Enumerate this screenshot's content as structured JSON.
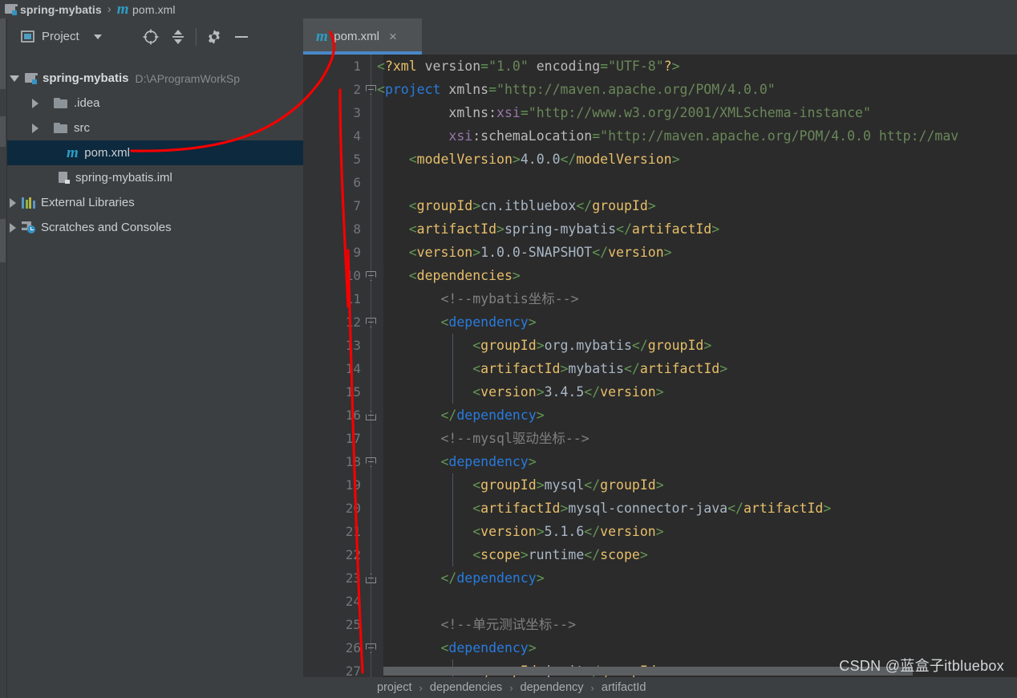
{
  "window": {
    "breadcrumb": [
      {
        "icon": "module-icon",
        "label": "spring-mybatis"
      },
      {
        "icon": "maven-icon",
        "label": "pom.xml"
      }
    ],
    "separator": "›"
  },
  "sidebar": {
    "title": "Project",
    "icons": [
      {
        "name": "locate-target-icon",
        "glyph": "crosshair"
      },
      {
        "name": "collapse-all-icon",
        "glyph": "collapse"
      },
      {
        "name": "settings-gear-icon",
        "glyph": "gear"
      },
      {
        "name": "hide-panel-icon",
        "glyph": "minus"
      }
    ],
    "tree": [
      {
        "label": "spring-mybatis",
        "path": "D:\\AProgramWorkSp",
        "icon": "module-icon",
        "state": "expanded",
        "indent": 0,
        "bold": true,
        "selected": false
      },
      {
        "label": ".idea",
        "path": "",
        "icon": "folder-icon",
        "state": "collapsed",
        "indent": 1,
        "bold": false,
        "selected": false
      },
      {
        "label": "src",
        "path": "",
        "icon": "folder-icon",
        "state": "collapsed",
        "indent": 1,
        "bold": false,
        "selected": false
      },
      {
        "label": "pom.xml",
        "path": "",
        "icon": "maven-icon",
        "state": "leaf",
        "indent": 1,
        "bold": false,
        "selected": true
      },
      {
        "label": "spring-mybatis.iml",
        "path": "",
        "icon": "iml-icon",
        "state": "leaf",
        "indent": 2,
        "bold": false,
        "selected": false
      },
      {
        "label": "External Libraries",
        "path": "",
        "icon": "library-icon",
        "state": "collapsed",
        "indent": 0,
        "bold": false,
        "selected": false
      },
      {
        "label": "Scratches and Consoles",
        "path": "",
        "icon": "scratches-icon",
        "state": "collapsed",
        "indent": 0,
        "bold": false,
        "selected": false
      }
    ]
  },
  "editor": {
    "tab": {
      "label": "pom.xml",
      "icon": "maven-icon",
      "close": "×",
      "active": true
    },
    "breadcrumb": [
      "project",
      "dependencies",
      "dependency",
      "artifactId"
    ],
    "breadcrumb_separator": "›",
    "first_line": 1,
    "last_line": 27,
    "code": [
      {
        "n": 1,
        "fold": "",
        "tokens": [
          [
            "br",
            "<"
          ],
          [
            "pi",
            "?xml"
          ],
          [
            "tg",
            " "
          ],
          [
            "at",
            "version"
          ],
          [
            "br",
            "="
          ],
          [
            "atv",
            "\"1.0\""
          ],
          [
            "at",
            " encoding"
          ],
          [
            "br",
            "="
          ],
          [
            "atv",
            "\"UTF-8\""
          ],
          [
            "pi",
            "?"
          ],
          [
            "br",
            ">"
          ]
        ]
      },
      {
        "n": 2,
        "fold": "open",
        "tokens": [
          [
            "br",
            "<"
          ],
          [
            "kb",
            "project"
          ],
          [
            "at",
            " xmlns"
          ],
          [
            "br",
            "="
          ],
          [
            "atv",
            "\"http://maven.apache.org/POM/4.0.0\""
          ]
        ]
      },
      {
        "n": 3,
        "fold": "",
        "tokens": [
          [
            "at",
            "         xmlns:"
          ],
          [
            "ns",
            "xsi"
          ],
          [
            "br",
            "="
          ],
          [
            "atv",
            "\"http://www.w3.org/2001/XMLSchema-instance\""
          ]
        ]
      },
      {
        "n": 4,
        "fold": "",
        "tokens": [
          [
            "ns",
            "         xsi"
          ],
          [
            "at",
            ":schemaLocation"
          ],
          [
            "br",
            "="
          ],
          [
            "atv",
            "\"http://maven.apache.org/POM/4.0.0 http://mav"
          ]
        ]
      },
      {
        "n": 5,
        "fold": "",
        "tokens": [
          [
            "br",
            "    <"
          ],
          [
            "tg",
            "modelVersion"
          ],
          [
            "br",
            ">"
          ],
          [
            "txt",
            "4.0.0"
          ],
          [
            "br",
            "</"
          ],
          [
            "tg",
            "modelVersion"
          ],
          [
            "br",
            ">"
          ]
        ]
      },
      {
        "n": 6,
        "fold": "",
        "tokens": []
      },
      {
        "n": 7,
        "fold": "",
        "tokens": [
          [
            "br",
            "    <"
          ],
          [
            "tg",
            "groupId"
          ],
          [
            "br",
            ">"
          ],
          [
            "txt",
            "cn.itbluebox"
          ],
          [
            "br",
            "</"
          ],
          [
            "tg",
            "groupId"
          ],
          [
            "br",
            ">"
          ]
        ]
      },
      {
        "n": 8,
        "fold": "",
        "tokens": [
          [
            "br",
            "    <"
          ],
          [
            "tg",
            "artifactId"
          ],
          [
            "br",
            ">"
          ],
          [
            "txt",
            "spring-mybatis"
          ],
          [
            "br",
            "</"
          ],
          [
            "tg",
            "artifactId"
          ],
          [
            "br",
            ">"
          ]
        ]
      },
      {
        "n": 9,
        "fold": "",
        "tokens": [
          [
            "br",
            "    <"
          ],
          [
            "tg",
            "version"
          ],
          [
            "br",
            ">"
          ],
          [
            "txt",
            "1.0.0-SNAPSHOT"
          ],
          [
            "br",
            "</"
          ],
          [
            "tg",
            "version"
          ],
          [
            "br",
            ">"
          ]
        ]
      },
      {
        "n": 10,
        "fold": "open",
        "tokens": [
          [
            "br",
            "    <"
          ],
          [
            "tg",
            "dependencies"
          ],
          [
            "br",
            ">"
          ]
        ]
      },
      {
        "n": 11,
        "fold": "",
        "tokens": [
          [
            "cm",
            "        <!--mybatis坐标-->"
          ]
        ]
      },
      {
        "n": 12,
        "fold": "open",
        "tokens": [
          [
            "br",
            "        <"
          ],
          [
            "kb",
            "dependency"
          ],
          [
            "br",
            ">"
          ]
        ]
      },
      {
        "n": 13,
        "fold": "",
        "tokens": [
          [
            "br",
            "            <"
          ],
          [
            "tg",
            "groupId"
          ],
          [
            "br",
            ">"
          ],
          [
            "txt",
            "org.mybatis"
          ],
          [
            "br",
            "</"
          ],
          [
            "tg",
            "groupId"
          ],
          [
            "br",
            ">"
          ]
        ]
      },
      {
        "n": 14,
        "fold": "",
        "tokens": [
          [
            "br",
            "            <"
          ],
          [
            "tg",
            "artifactId"
          ],
          [
            "br",
            ">"
          ],
          [
            "txt",
            "mybatis"
          ],
          [
            "br",
            "</"
          ],
          [
            "tg",
            "artifactId"
          ],
          [
            "br",
            ">"
          ]
        ]
      },
      {
        "n": 15,
        "fold": "",
        "tokens": [
          [
            "br",
            "            <"
          ],
          [
            "tg",
            "version"
          ],
          [
            "br",
            ">"
          ],
          [
            "txt",
            "3.4.5"
          ],
          [
            "br",
            "</"
          ],
          [
            "tg",
            "version"
          ],
          [
            "br",
            ">"
          ]
        ]
      },
      {
        "n": 16,
        "fold": "close",
        "tokens": [
          [
            "br",
            "        </"
          ],
          [
            "kb",
            "dependency"
          ],
          [
            "br",
            ">"
          ]
        ]
      },
      {
        "n": 17,
        "fold": "",
        "tokens": [
          [
            "cm",
            "        <!--mysql驱动坐标-->"
          ]
        ]
      },
      {
        "n": 18,
        "fold": "open",
        "tokens": [
          [
            "br",
            "        <"
          ],
          [
            "kb",
            "dependency"
          ],
          [
            "br",
            ">"
          ]
        ]
      },
      {
        "n": 19,
        "fold": "",
        "tokens": [
          [
            "br",
            "            <"
          ],
          [
            "tg",
            "groupId"
          ],
          [
            "br",
            ">"
          ],
          [
            "txt",
            "mysql"
          ],
          [
            "br",
            "</"
          ],
          [
            "tg",
            "groupId"
          ],
          [
            "br",
            ">"
          ]
        ]
      },
      {
        "n": 20,
        "fold": "",
        "tokens": [
          [
            "br",
            "            <"
          ],
          [
            "tg",
            "artifactId"
          ],
          [
            "br",
            ">"
          ],
          [
            "txt",
            "mysql-connector-java"
          ],
          [
            "br",
            "</"
          ],
          [
            "tg",
            "artifactId"
          ],
          [
            "br",
            ">"
          ]
        ]
      },
      {
        "n": 21,
        "fold": "",
        "tokens": [
          [
            "br",
            "            <"
          ],
          [
            "tg",
            "version"
          ],
          [
            "br",
            ">"
          ],
          [
            "txt",
            "5.1.6"
          ],
          [
            "br",
            "</"
          ],
          [
            "tg",
            "version"
          ],
          [
            "br",
            ">"
          ]
        ]
      },
      {
        "n": 22,
        "fold": "",
        "tokens": [
          [
            "br",
            "            <"
          ],
          [
            "tg",
            "scope"
          ],
          [
            "br",
            ">"
          ],
          [
            "txt",
            "runtime"
          ],
          [
            "br",
            "</"
          ],
          [
            "tg",
            "scope"
          ],
          [
            "br",
            ">"
          ]
        ]
      },
      {
        "n": 23,
        "fold": "close",
        "tokens": [
          [
            "br",
            "        </"
          ],
          [
            "kb",
            "dependency"
          ],
          [
            "br",
            ">"
          ]
        ]
      },
      {
        "n": 24,
        "fold": "",
        "tokens": []
      },
      {
        "n": 25,
        "fold": "",
        "tokens": [
          [
            "cm",
            "        <!--单元测试坐标-->"
          ]
        ]
      },
      {
        "n": 26,
        "fold": "open",
        "tokens": [
          [
            "br",
            "        <"
          ],
          [
            "kb",
            "dependency"
          ],
          [
            "br",
            ">"
          ]
        ]
      },
      {
        "n": 27,
        "fold": "",
        "tokens": [
          [
            "br",
            "            <"
          ],
          [
            "tg",
            "groupId"
          ],
          [
            "br",
            ">"
          ],
          [
            "txt",
            "junit"
          ],
          [
            "br",
            "</"
          ],
          [
            "tg",
            "groupId"
          ],
          [
            "br",
            ">"
          ]
        ]
      }
    ]
  },
  "watermark": "CSDN @蓝盒子itbluebox",
  "colors": {
    "panel_bg": "#3c3f41",
    "editor_bg": "#2b2b2b",
    "gutter_bg": "#313335",
    "selection_bg": "#0d293e",
    "tab_active_bg": "#4e5254",
    "tab_underline": "#4a88c7",
    "accent_blue": "#3592c4",
    "maven_icon": "#2d9ec7",
    "annotation_red": "#f40000",
    "token_tag": "#e8bf6a",
    "token_bracket": "#629755",
    "token_attr_value": "#6a8759",
    "token_text": "#a9b7c6",
    "token_comment": "#808080",
    "token_keyword": "#287bde",
    "token_ns": "#9876aa"
  }
}
